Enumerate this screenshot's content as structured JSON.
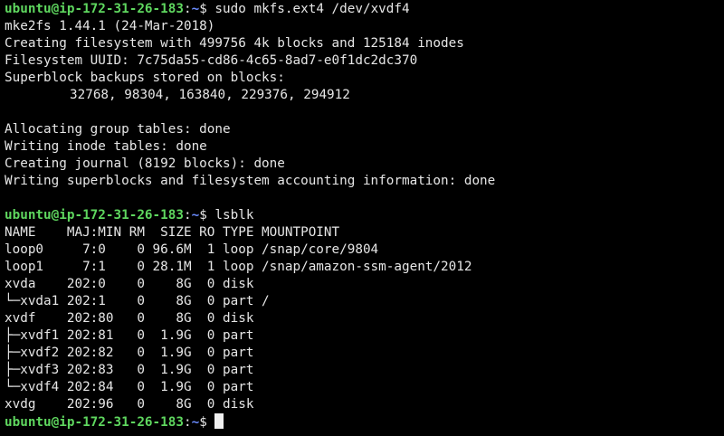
{
  "theme": {
    "background": "#000000",
    "foreground": "#e6e6e6",
    "prompt_user_color": "#5fd75f",
    "prompt_path_color": "#6b8cff"
  },
  "prompt": {
    "user_host": "ubuntu@ip-172-31-26-183",
    "separator": ":",
    "path": "~",
    "symbol": "$ "
  },
  "commands": {
    "mkfs": "sudo mkfs.ext4 /dev/xvdf4",
    "lsblk": "lsblk",
    "final": ""
  },
  "mkfs_output": [
    "mke2fs 1.44.1 (24-Mar-2018)",
    "Creating filesystem with 499756 4k blocks and 125184 inodes",
    "Filesystem UUID: 7c75da55-cd86-4c65-8ad7-e0f1dc2dc370",
    "Superblock backups stored on blocks:",
    "\t32768, 98304, 163840, 229376, 294912",
    "",
    "Allocating group tables: done",
    "Writing inode tables: done",
    "Creating journal (8192 blocks): done",
    "Writing superblocks and filesystem accounting information: done",
    ""
  ],
  "lsblk_output": [
    "NAME    MAJ:MIN RM  SIZE RO TYPE MOUNTPOINT",
    "loop0     7:0    0 96.6M  1 loop /snap/core/9804",
    "loop1     7:1    0 28.1M  1 loop /snap/amazon-ssm-agent/2012",
    "xvda    202:0    0    8G  0 disk",
    "└─xvda1 202:1    0    8G  0 part /",
    "xvdf    202:80   0    8G  0 disk",
    "├─xvdf1 202:81   0  1.9G  0 part",
    "├─xvdf2 202:82   0  1.9G  0 part",
    "├─xvdf3 202:83   0  1.9G  0 part",
    "└─xvdf4 202:84   0  1.9G  0 part",
    "xvdg    202:96   0    8G  0 disk"
  ]
}
